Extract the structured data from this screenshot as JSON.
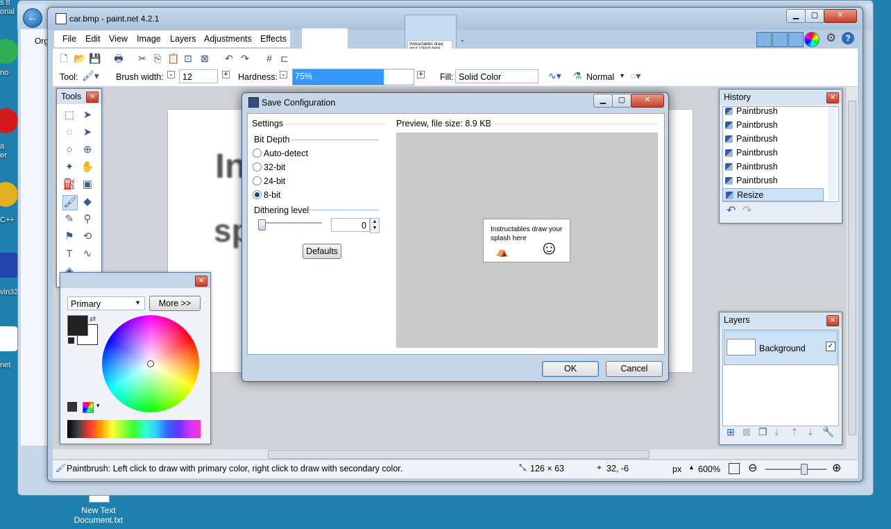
{
  "desktop": {
    "labels": [
      "s 8\nonal",
      "no",
      "a\ner",
      "C++",
      "vin32",
      "net"
    ],
    "file_label": "New Text\nDocument.txt"
  },
  "explorer": {
    "back_glyph": "←",
    "address_frag": "Org"
  },
  "window": {
    "title": "car.bmp - paint.net 4.2.1",
    "min": "▁",
    "max": "▢",
    "close": "✕"
  },
  "menu": [
    "File",
    "Edit",
    "View",
    "Image",
    "Layers",
    "Adjustments",
    "Effects"
  ],
  "toolbar": {
    "tool_label": "Tool:",
    "brush_width_label": "Brush width:",
    "brush_width_value": "12",
    "hardness_label": "Hardness:",
    "hardness_value": "75%",
    "hardness_fraction": 0.75,
    "fill_label": "Fill:",
    "fill_value": "Solid Color",
    "blend_value": "Normal"
  },
  "thumbnail": {
    "text": "Instructables draw your splash here"
  },
  "tools_panel": {
    "title": "Tools",
    "icons": [
      "rectangle-select-icon",
      "move-selection-icon",
      "lasso-select-icon",
      "move-selected-icon",
      "ellipse-select-icon",
      "zoom-icon",
      "magic-wand-icon",
      "pan-icon",
      "paint-bucket-icon",
      "gradient-icon",
      "paintbrush-icon",
      "eraser-icon",
      "pencil-icon",
      "color-picker-icon",
      "clone-stamp-icon",
      "recolor-icon",
      "text-icon",
      "line-curve-icon",
      "shapes-icon"
    ],
    "glyphs": [
      "⬚",
      "➤",
      "◌",
      "➤",
      "○",
      "⊕",
      "✦",
      "✋",
      "⛽",
      "▣",
      "🖌",
      "◆",
      "✎",
      "⚲",
      "⚑",
      "⟲",
      "T",
      "∿",
      "◈"
    ]
  },
  "colors_panel": {
    "mode": "Primary",
    "more": "More >>"
  },
  "history_panel": {
    "title": "History",
    "items": [
      "Paintbrush",
      "Paintbrush",
      "Paintbrush",
      "Paintbrush",
      "Paintbrush",
      "Paintbrush",
      "Resize"
    ],
    "undo": "↶",
    "redo": "↷"
  },
  "layers_panel": {
    "title": "Layers",
    "layer_name": "Background",
    "check": "✓"
  },
  "dialog": {
    "title": "Save Configuration",
    "settings": "Settings",
    "preview": "Preview, file size: 8.9 KB",
    "bit_depth": "Bit Depth",
    "options": [
      "Auto-detect",
      "32-bit",
      "24-bit",
      "8-bit"
    ],
    "selected": "8-bit",
    "dithering_label": "Dithering level",
    "dithering_value": "0",
    "defaults": "Defaults",
    "ok": "OK",
    "cancel": "Cancel",
    "preview_text": "Instructables draw your splash here"
  },
  "canvas": {
    "frag1": "In",
    "frag2": "sp"
  },
  "statusbar": {
    "message": "Paintbrush: Left click to draw with primary color, right click to draw with secondary color.",
    "size": "126 × 63",
    "pos": "32, -6",
    "unit": "px",
    "zoom": "600%"
  },
  "colors": {
    "accent": "#3399ff",
    "titlebar": "#b9cde3"
  }
}
